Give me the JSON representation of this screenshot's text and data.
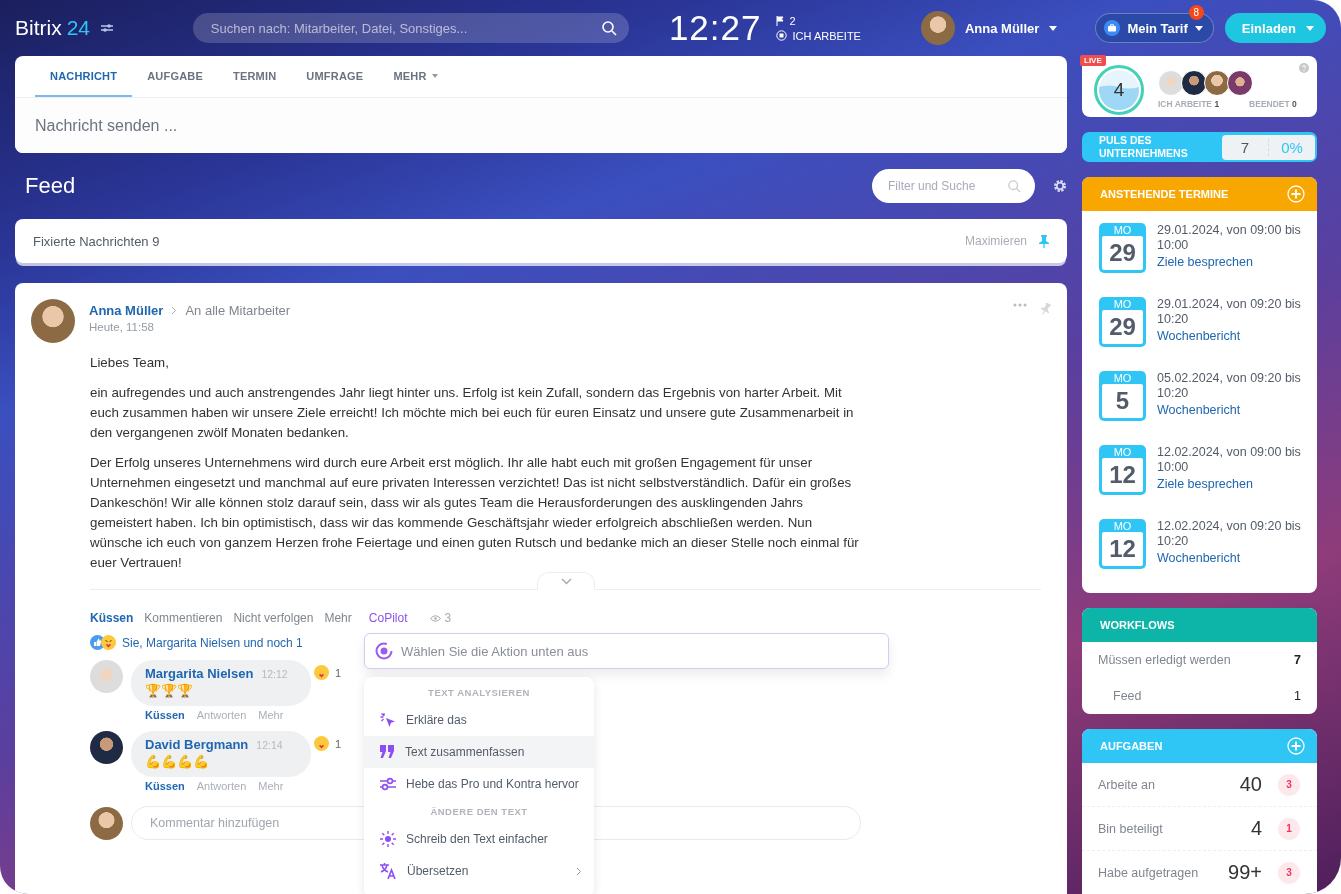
{
  "header": {
    "logo_text": "Bitrix",
    "logo_number": "24",
    "search_placeholder": "Suchen nach: Mitarbeiter, Datei, Sonstiges...",
    "clock": "12:27",
    "flag_count": "2",
    "work_status": "ICH ARBEITE",
    "user_name": "Anna Müller",
    "tariff": "Mein Tarif",
    "tariff_badge": "8",
    "invite": "Einladen"
  },
  "composer": {
    "tabs": [
      {
        "label": "NACHRICHT",
        "selected": true,
        "dropdown": false
      },
      {
        "label": "AUFGABE",
        "selected": false,
        "dropdown": false
      },
      {
        "label": "TERMIN",
        "selected": false,
        "dropdown": false
      },
      {
        "label": "UMFRAGE",
        "selected": false,
        "dropdown": false
      },
      {
        "label": "MEHR",
        "selected": false,
        "dropdown": true
      }
    ],
    "placeholder": "Nachricht senden ..."
  },
  "feed": {
    "title": "Feed",
    "filter_placeholder": "Filter und Suche"
  },
  "pinned": {
    "label": "Fixierte Nachrichten 9",
    "action": "Maximieren"
  },
  "post": {
    "author": "Anna Müller",
    "recipient": "An alle Mitarbeiter",
    "time": "Heute, 11:58",
    "paragraphs": [
      "Liebes Team,",
      "ein aufregendes und auch anstrengendes Jahr liegt hinter uns. Erfolg ist kein Zufall, sondern das Ergebnis von harter Arbeit. Mit euch zusammen haben wir unsere Ziele erreicht! Ich möchte mich bei euch für euren Einsatz und unsere gute Zusammenarbeit in den vergangenen zwölf Monaten bedanken.",
      "Der Erfolg unseres Unternehmens wird durch eure Arbeit erst möglich. Ihr alle habt euch mit großen Engagement für unser Unternehmen eingesetzt und manchmal auf eure privaten Interessen verzichtet! Das ist nicht selbstverständlich. Dafür ein großes Dankeschön! Wir alle können stolz darauf sein, dass wir als gutes Team die Herausforderungen des ausklingenden Jahrs gemeistert haben. Ich bin optimistisch, dass wir das kommende Geschäftsjahr wieder erfolgreich abschließen werden. Nun wünsche ich euch von ganzem Herzen frohe Feiertage und einen guten Rutsch und bedanke mich an dieser Stelle noch einmal für euer Vertrauen!"
    ],
    "actions": [
      {
        "label": "Küssen",
        "kind": "primary"
      },
      {
        "label": "Kommentieren",
        "kind": "plain"
      },
      {
        "label": "Nicht verfolgen",
        "kind": "plain"
      },
      {
        "label": "Mehr",
        "kind": "plain"
      },
      {
        "label": "CoPilot",
        "kind": "copilot"
      }
    ],
    "views": "3",
    "reactions": "Sie, Margarita Nielsen und noch 1",
    "comments": [
      {
        "author": "Margarita Nielsen",
        "time": "12:12",
        "emoji": "🏆🏆🏆",
        "reaction_count": "1",
        "actions": [
          {
            "label": "Küssen",
            "kind": "primary"
          },
          {
            "label": "Antworten",
            "kind": "plain"
          },
          {
            "label": "Mehr",
            "kind": "plain"
          }
        ]
      },
      {
        "author": "David Bergmann",
        "time": "12:14",
        "emoji": "💪💪💪💪",
        "reaction_count": "1",
        "actions": [
          {
            "label": "Küssen",
            "kind": "primary"
          },
          {
            "label": "Antworten",
            "kind": "plain"
          },
          {
            "label": "Mehr",
            "kind": "plain"
          }
        ]
      }
    ],
    "comment_placeholder": "Kommentar hinzufügen"
  },
  "copilot": {
    "placeholder": "Wählen Sie die Aktion unten aus",
    "sections": [
      {
        "title": "TEXT ANALYSIEREN",
        "items": [
          {
            "label": "Erkläre das",
            "selected": false,
            "submenu": false
          },
          {
            "label": "Text zusammenfassen",
            "selected": true,
            "submenu": false
          },
          {
            "label": "Hebe das Pro und Kontra hervor",
            "selected": false,
            "submenu": false
          }
        ]
      },
      {
        "title": "ÄNDERE DEN TEXT",
        "items": [
          {
            "label": "Schreib den Text einfacher",
            "selected": false,
            "submenu": false
          },
          {
            "label": "Übersetzen",
            "selected": false,
            "submenu": true
          }
        ]
      }
    ]
  },
  "sidebar": {
    "live": {
      "badge": "LIVE",
      "count": "4",
      "working_label": "ICH ARBEITE",
      "working": "1",
      "done_label": "BEENDET",
      "done": "0"
    },
    "pulse": {
      "title": "PULS DES UNTERNEHMENS",
      "value": "7",
      "percent": "0%"
    },
    "events": {
      "title": "ANSTEHENDE TERMINE",
      "items": [
        {
          "weekday": "MO",
          "day": "29",
          "when": "29.01.2024, von 09:00 bis 10:00",
          "title": "Ziele besprechen"
        },
        {
          "weekday": "MO",
          "day": "29",
          "when": "29.01.2024, von 09:20 bis 10:20",
          "title": "Wochenbericht"
        },
        {
          "weekday": "MO",
          "day": "5",
          "when": "05.02.2024, von 09:20 bis 10:20",
          "title": "Wochenbericht"
        },
        {
          "weekday": "MO",
          "day": "12",
          "when": "12.02.2024, von 09:00 bis 10:00",
          "title": "Ziele besprechen"
        },
        {
          "weekday": "MO",
          "day": "12",
          "when": "12.02.2024, von 09:20 bis 10:20",
          "title": "Wochenbericht"
        }
      ]
    },
    "workflows": {
      "title": "WORKFLOWS",
      "rows": [
        {
          "label": "Müssen erledigt werden",
          "value": "7",
          "indent": false
        },
        {
          "label": "Feed",
          "value": "1",
          "indent": true
        }
      ]
    },
    "tasks": {
      "title": "AUFGABEN",
      "rows": [
        {
          "label": "Arbeite an",
          "value": "40",
          "badge": "3"
        },
        {
          "label": "Bin beteiligt",
          "value": "4",
          "badge": "1"
        },
        {
          "label": "Habe aufgetragen",
          "value": "99+",
          "badge": "3"
        }
      ]
    }
  }
}
